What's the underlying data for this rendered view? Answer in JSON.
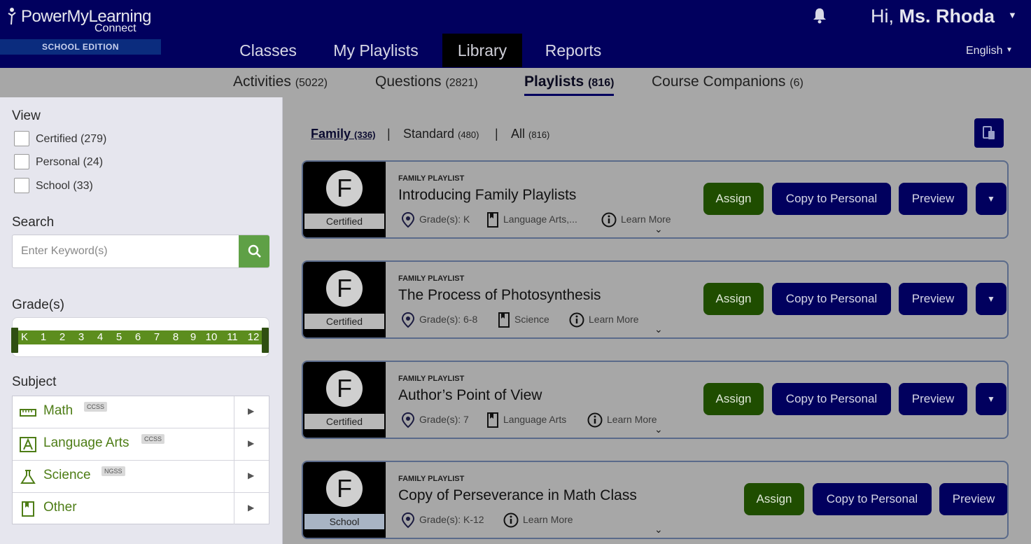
{
  "brand": {
    "line1": "PowerMyLearning",
    "line2": "Connect",
    "edition": "SCHOOL EDITION"
  },
  "nav": {
    "items": [
      "Classes",
      "My Playlists",
      "Library",
      "Reports"
    ],
    "active": "Library"
  },
  "user": {
    "greeting": "Hi,",
    "name": "Ms. Rhoda"
  },
  "language": "English",
  "subnav": [
    {
      "label": "Activities",
      "count": "(5022)"
    },
    {
      "label": "Questions",
      "count": "(2821)"
    },
    {
      "label": "Playlists",
      "count": "(816)",
      "active": true
    },
    {
      "label": "Course Companions",
      "count": "(6)"
    }
  ],
  "sidebar": {
    "view_heading": "View",
    "view_options": [
      "Certified (279)",
      "Personal (24)",
      "School (33)"
    ],
    "search_heading": "Search",
    "search_placeholder": "Enter Keyword(s)",
    "grades_heading": "Grade(s)",
    "grades": [
      "K",
      "1",
      "2",
      "3",
      "4",
      "5",
      "6",
      "7",
      "8",
      "9",
      "10",
      "11",
      "12"
    ],
    "subject_heading": "Subject",
    "subjects": [
      {
        "name": "Math",
        "tag": "CCSS",
        "icon": "ruler-icon"
      },
      {
        "name": "Language Arts",
        "tag": "CCSS",
        "icon": "letter-a-icon"
      },
      {
        "name": "Science",
        "tag": "NGSS",
        "icon": "flask-icon"
      },
      {
        "name": "Other",
        "tag": "",
        "icon": "bookmark-icon"
      }
    ]
  },
  "filters": [
    {
      "label": "Family",
      "count": "(336)",
      "active": true
    },
    {
      "label": "Standard",
      "count": "(480)"
    },
    {
      "label": "All",
      "count": "(816)"
    }
  ],
  "buttons": {
    "assign": "Assign",
    "copy": "Copy to Personal",
    "preview": "Preview",
    "more": "▼"
  },
  "learn_more": "Learn More",
  "playlists": [
    {
      "type": "FAMILY PLAYLIST",
      "title": "Introducing Family Playlists",
      "badge_letter": "F",
      "badge": "Certified",
      "grades": "Grade(s): K",
      "subject": "Language Arts,..."
    },
    {
      "type": "FAMILY PLAYLIST",
      "title": "The Process of Photosynthesis",
      "badge_letter": "F",
      "badge": "Certified",
      "grades": "Grade(s): 6-8",
      "subject": "Science"
    },
    {
      "type": "FAMILY PLAYLIST",
      "title": "Author’s Point of View",
      "badge_letter": "F",
      "badge": "Certified",
      "grades": "Grade(s): 7",
      "subject": "Language Arts"
    },
    {
      "type": "FAMILY PLAYLIST",
      "title": "Copy of Perseverance in Math Class",
      "badge_letter": "F",
      "badge": "School",
      "grades": "Grade(s): K-12",
      "subject": ""
    }
  ],
  "colors": {
    "header": "#01005e",
    "accent_green": "#5c8d1e",
    "assign_green": "#1f4d00",
    "overlay_gray": "#a7a7a7"
  }
}
